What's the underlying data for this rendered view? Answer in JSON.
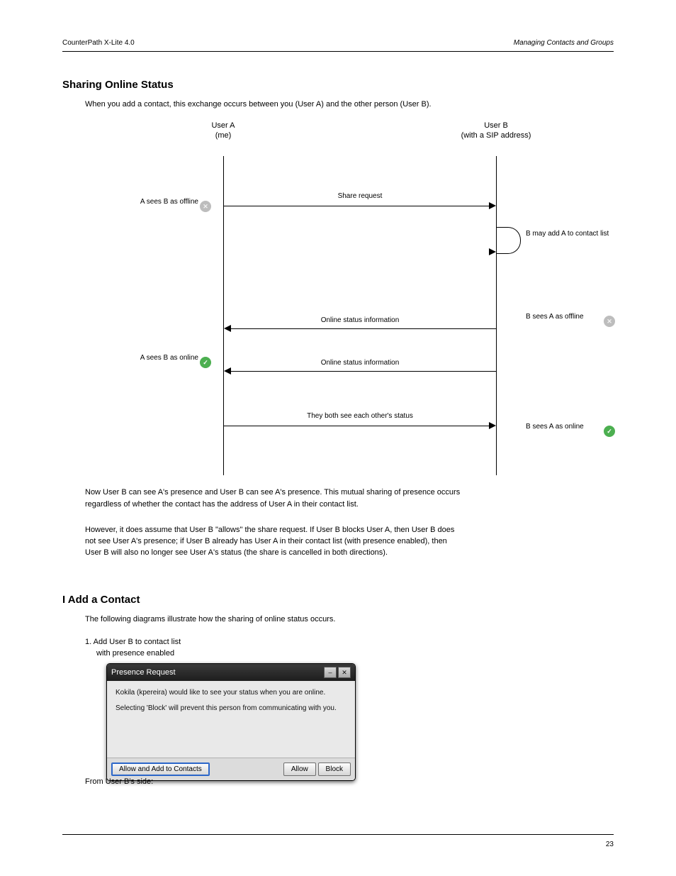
{
  "header": {
    "left": "CounterPath X-Lite 4.0",
    "right": "Managing Contacts and Groups"
  },
  "footer": {
    "right": "23"
  },
  "headings": {
    "h1": "Sharing Online Status",
    "flow": "I Add a Contact"
  },
  "text": {
    "intro": "When you add a contact, this exchange occurs between you (User A) and the other person (User B).",
    "summary1": "Now User B can see A's presence and User B can see A's presence. This mutual sharing of presence occurs",
    "summary2": "regardless of whether the contact has the address of User A in their contact list.",
    "caveat1": "However, it does assume that User B \"allows\" the share request. If User B blocks User A, then User B does",
    "caveat2": "not see User A's presence; if User B already has User A in their contact list (with presence enabled), then",
    "caveat3": "User B will also no longer see User A's status (the share is cancelled in both directions).",
    "flow1": "The following diagrams illustrate how the sharing of online status occurs.",
    "step1": "1. Add User B to contact list",
    "step1w": "with presence enabled",
    "from_b": "From User B's side:"
  },
  "diagram": {
    "actor_a": "User A\n(me)",
    "actor_b": "User B\n(with a SIP address)",
    "msg_share_request": "Share request",
    "self_loop_text": "B may add A to contact list",
    "left_note_1": "A sees B as\noffline",
    "right_note_1": "B sees A as\noffline",
    "msg_allow": "Online status information",
    "left_note_2": "A sees B as\nonline",
    "msg_online_status": "Online status information",
    "right_note_2": "B sees A as\nonline",
    "msg_ack": "They both see each other's status"
  },
  "dialog": {
    "title": "Presence Request",
    "line1": "Kokila (kpereira) would like to see your status when you are online.",
    "line2": "Selecting 'Block' will prevent this person from communicating with you.",
    "btn_add": "Allow and Add to Contacts",
    "btn_allow": "Allow",
    "btn_block": "Block"
  }
}
